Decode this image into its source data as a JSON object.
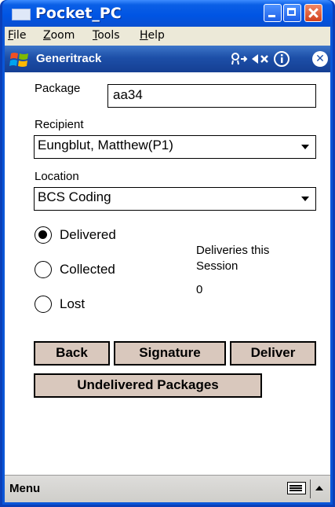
{
  "window": {
    "title": "Pocket_PC"
  },
  "menubar": {
    "items": [
      "File",
      "Zoom",
      "Tools",
      "Help"
    ]
  },
  "app": {
    "title": "Generitrack",
    "ok_label": "✕"
  },
  "form": {
    "package_label": "Package",
    "package_value": "aa34",
    "recipient_label": "Recipient",
    "recipient_value": "Eungblut, Matthew(P1)",
    "location_label": "Location",
    "location_value": "BCS Coding",
    "status_options": [
      {
        "label": "Delivered",
        "selected": true
      },
      {
        "label": "Collected",
        "selected": false
      },
      {
        "label": "Lost",
        "selected": false
      }
    ],
    "deliveries_label_line1": "Deliveries this",
    "deliveries_label_line2": "Session",
    "deliveries_count": "0"
  },
  "buttons": {
    "back": "Back",
    "signature": "Signature",
    "deliver": "Deliver",
    "undelivered": "Undelivered Packages"
  },
  "softkeys": {
    "menu": "Menu"
  },
  "icons": {
    "window": "window-icon",
    "start": "windows-logo-icon",
    "connectivity": "connectivity-icon",
    "volume": "speaker-muted-icon",
    "battery": "info-icon",
    "ok": "close-circle-icon",
    "keyboard": "keyboard-icon"
  },
  "colors": {
    "xp_title_blue": "#0054e3",
    "app_title_blue": "#1d4fa8",
    "button_fill": "#d9c8bd",
    "menubar_bg": "#ece9d8"
  }
}
